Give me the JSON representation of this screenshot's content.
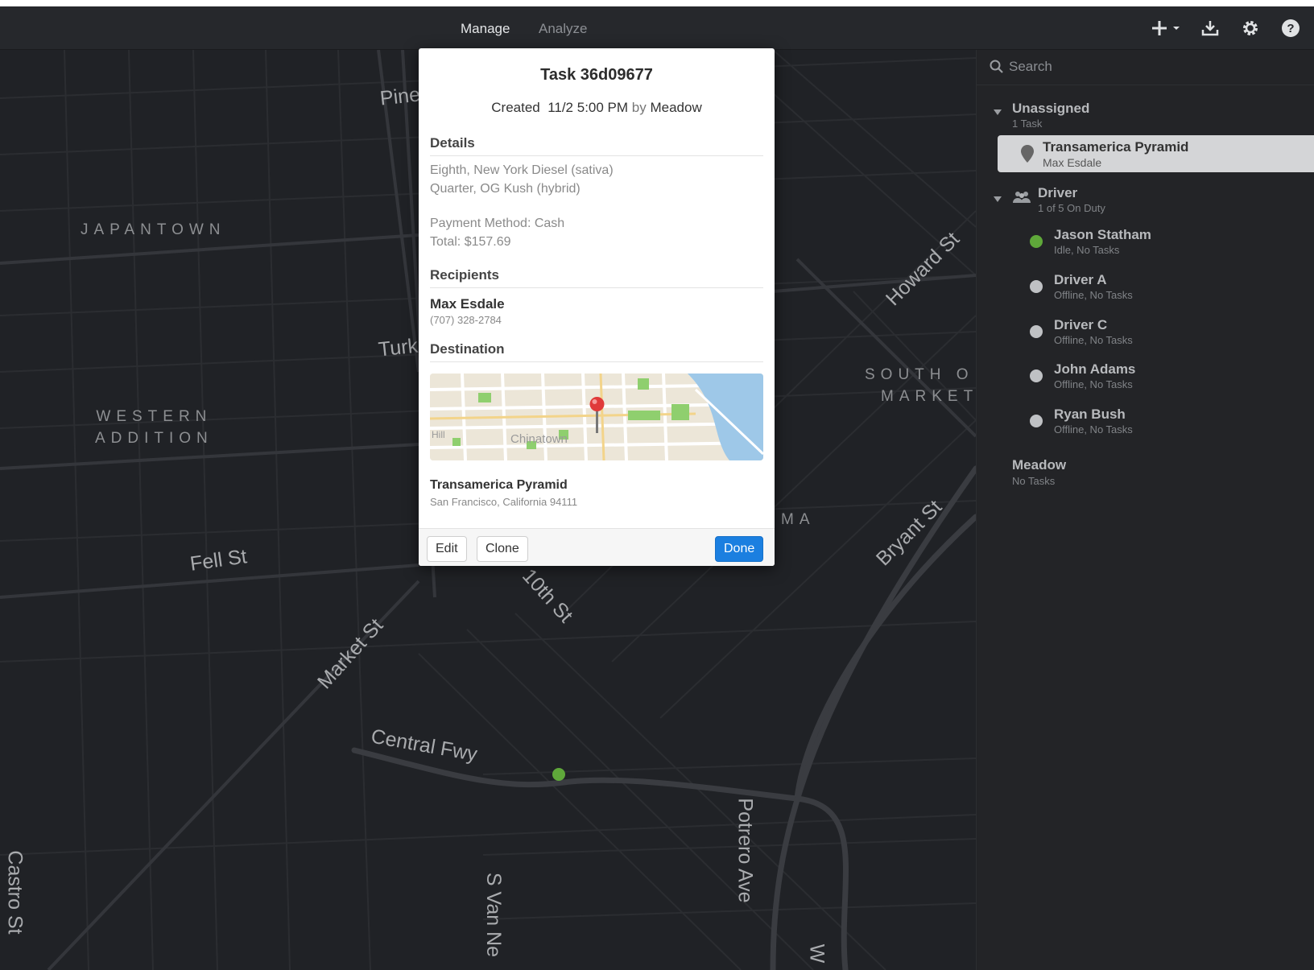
{
  "nav": {
    "tabs": [
      "Manage",
      "Analyze"
    ],
    "active": "Manage",
    "icons": [
      "plus-dropdown-icon",
      "download-icon",
      "gear-icon",
      "help-icon"
    ]
  },
  "map": {
    "streets": [
      "Pine",
      "Turk",
      "Howard St",
      "Fell St",
      "Market St",
      "10th St",
      "Central Fwy",
      "Bryant St",
      "S Van Ne",
      "Potrero Ave",
      "Castro St",
      "W"
    ],
    "districts": {
      "japantown": "JAPANTOWN",
      "western_addition": [
        "WESTERN",
        "ADDITION"
      ],
      "south_of_market": [
        "SOUTH O",
        "MARKET"
      ],
      "ma_fragment": "MA"
    }
  },
  "task": {
    "title": "Task 36d09677",
    "created_label": "Created",
    "created_value": "11/2 5:00 PM",
    "created_by_label": "by",
    "created_by": "Meadow",
    "details_heading": "Details",
    "items": [
      "Eighth, New York Diesel (sativa)",
      "Quarter, OG Kush (hybrid)"
    ],
    "payment_method": "Payment Method: Cash",
    "total": "Total: $157.69",
    "recipients_heading": "Recipients",
    "recipient_name": "Max Esdale",
    "recipient_phone": "(707) 328-2784",
    "destination_heading": "Destination",
    "minimap_labels": [
      "Chinatown",
      "Hill"
    ],
    "destination_name": "Transamerica Pyramid",
    "destination_address": "San Francisco, California 94111",
    "buttons": {
      "edit": "Edit",
      "clone": "Clone",
      "done": "Done"
    }
  },
  "sidebar": {
    "search_placeholder": "Search",
    "unassigned": {
      "title": "Unassigned",
      "count": "1 Task"
    },
    "unassigned_task": {
      "name": "Transamerica Pyramid",
      "recipient": "Max Esdale"
    },
    "driver_group": {
      "title": "Driver",
      "count": "1 of 5 On Duty"
    },
    "drivers": [
      {
        "name": "Jason Statham",
        "status": "Idle, No Tasks",
        "color": "#5fa83a"
      },
      {
        "name": "Driver A",
        "status": "Offline, No Tasks",
        "color": "#bfc1c4"
      },
      {
        "name": "Driver C",
        "status": "Offline, No Tasks",
        "color": "#bfc1c4"
      },
      {
        "name": "John Adams",
        "status": "Offline, No Tasks",
        "color": "#bfc1c4"
      },
      {
        "name": "Ryan Bush",
        "status": "Offline, No Tasks",
        "color": "#bfc1c4"
      }
    ],
    "meadow": {
      "title": "Meadow",
      "sub": "No Tasks"
    }
  },
  "colors": {
    "accent": "#1b7fe0",
    "driver_online": "#5fa83a",
    "driver_offline": "#bfc1c4"
  }
}
